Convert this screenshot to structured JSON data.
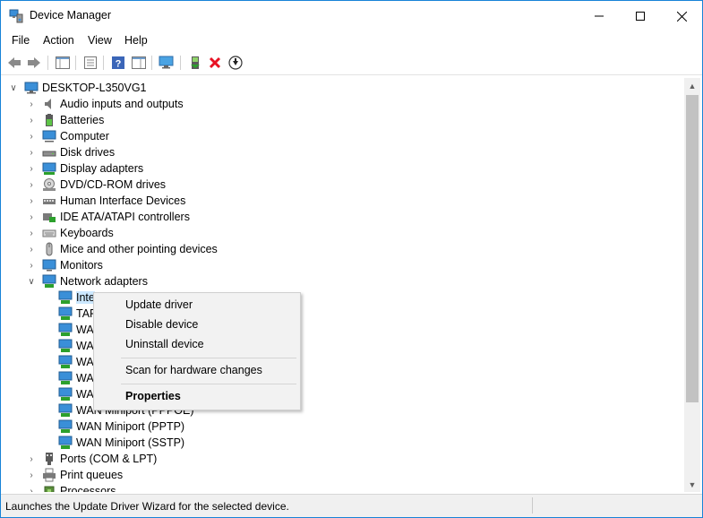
{
  "window": {
    "title": "Device Manager"
  },
  "menu": [
    "File",
    "Action",
    "View",
    "Help"
  ],
  "tree": {
    "root": "DESKTOP-L350VG1",
    "categories": [
      {
        "label": "Audio inputs and outputs",
        "icon": "speaker-icon"
      },
      {
        "label": "Batteries",
        "icon": "battery-icon"
      },
      {
        "label": "Computer",
        "icon": "computer-icon"
      },
      {
        "label": "Disk drives",
        "icon": "disk-drive-icon"
      },
      {
        "label": "Display adapters",
        "icon": "display-adapter-icon"
      },
      {
        "label": "DVD/CD-ROM drives",
        "icon": "dvd-drive-icon"
      },
      {
        "label": "Human Interface Devices",
        "icon": "hid-icon"
      },
      {
        "label": "IDE ATA/ATAPI controllers",
        "icon": "ide-controller-icon"
      },
      {
        "label": "Keyboards",
        "icon": "keyboard-icon"
      },
      {
        "label": "Mice and other pointing devices",
        "icon": "mouse-icon"
      },
      {
        "label": "Monitors",
        "icon": "monitor-icon"
      },
      {
        "label": "Network adapters",
        "icon": "network-adapter-icon"
      }
    ],
    "network_children": [
      "Inte",
      "TAP",
      "WAN",
      "WAN",
      "WAN",
      "WAN",
      "WAN",
      "WAN Miniport (PPPOE)",
      "WAN Miniport (PPTP)",
      "WAN Miniport (SSTP)"
    ],
    "after": [
      {
        "label": "Ports (COM & LPT)",
        "icon": "port-icon"
      },
      {
        "label": "Print queues",
        "icon": "printer-icon"
      },
      {
        "label": "Processors",
        "icon": "processor-icon"
      }
    ]
  },
  "context_menu": {
    "update_driver": "Update driver",
    "disable_device": "Disable device",
    "uninstall_device": "Uninstall device",
    "scan_hardware": "Scan for hardware changes",
    "properties": "Properties"
  },
  "status": {
    "text": "Launches the Update Driver Wizard for the selected device."
  },
  "colors": {
    "selection": "#cce8ff",
    "window_border": "#1883d7",
    "uninstall_red": "#e81123"
  }
}
